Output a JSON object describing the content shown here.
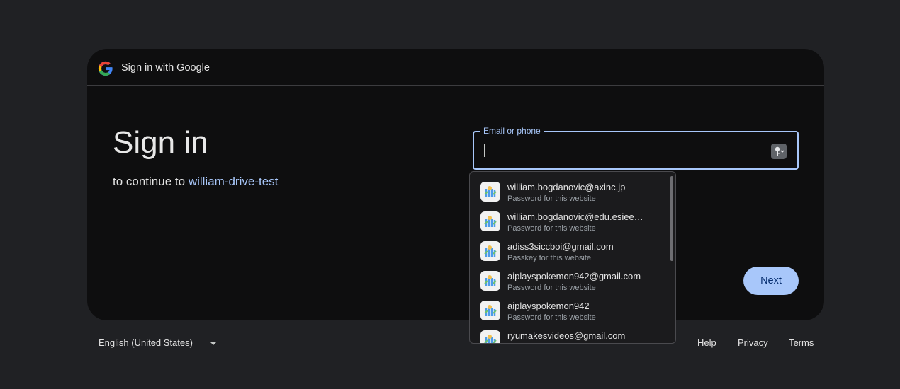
{
  "header": {
    "title": "Sign in with Google"
  },
  "main": {
    "title": "Sign in",
    "subtitle_prefix": "to continue to",
    "app_name": "william-drive-test"
  },
  "email_field": {
    "label": "Email or phone",
    "value": ""
  },
  "next_label": "Next",
  "autofill": [
    {
      "title": "william.bogdanovic@axinc.jp",
      "subtitle": "Password for this website"
    },
    {
      "title": "william.bogdanovic@edu.esiee…",
      "subtitle": "Password for this website"
    },
    {
      "title": "adiss3siccboi@gmail.com",
      "subtitle": "Passkey for this website"
    },
    {
      "title": "aiplayspokemon942@gmail.com",
      "subtitle": "Password for this website"
    },
    {
      "title": "aiplayspokemon942",
      "subtitle": "Password for this website"
    },
    {
      "title": "ryumakesvideos@gmail.com",
      "subtitle": ""
    }
  ],
  "footer": {
    "language": "English (United States)",
    "help": "Help",
    "privacy": "Privacy",
    "terms": "Terms"
  },
  "icons": {
    "logo": "google-g-logo",
    "key": "passwords-key-icon",
    "autofill_item": "passwords-app-icon",
    "language_menu": "dropdown-caret-icon"
  },
  "colors": {
    "accent": "#a8c7fa",
    "next_text": "#062e6f",
    "card_bg": "#0e0e0f",
    "page_bg": "#202124"
  }
}
